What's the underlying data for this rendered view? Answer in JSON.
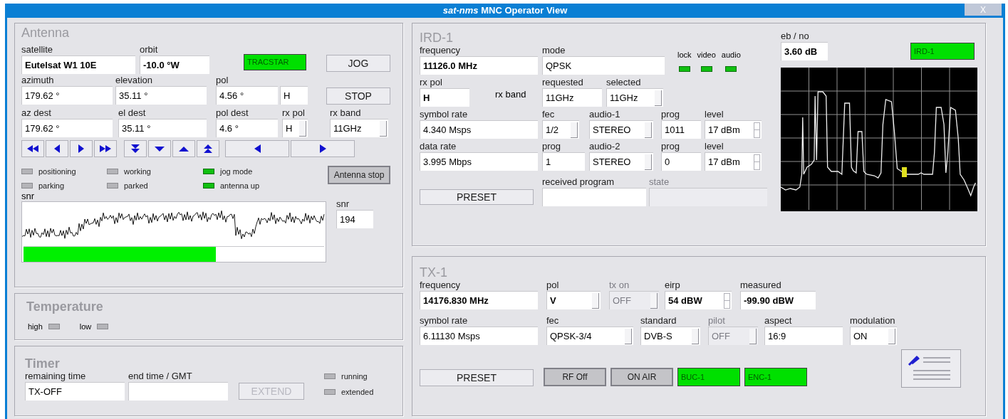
{
  "window": {
    "title": "*sat-nms* MNC Operator View",
    "close": "X"
  },
  "antenna": {
    "title": "Antenna",
    "fields": [
      {
        "label": "satellite",
        "value": "Eutelsat W1 10E",
        "bold": true,
        "kind": "text"
      },
      {
        "label": "orbit",
        "value": "-10.0 °W",
        "bold": true,
        "kind": "text"
      },
      {
        "label": "azimuth",
        "value": "179.62 °",
        "bold": false,
        "kind": "text"
      },
      {
        "label": "elevation",
        "value": "35.11 °",
        "bold": false,
        "kind": "text"
      },
      {
        "label": "pol",
        "value": "4.56 °",
        "bold": false,
        "kind": "text"
      },
      {
        "value": "H",
        "bold": false,
        "kind": "text"
      },
      {
        "label": "az dest",
        "value": "179.62 °",
        "bold": false,
        "kind": "text"
      },
      {
        "label": "el dest",
        "value": "35.11 °",
        "bold": false,
        "kind": "text"
      },
      {
        "label": "pol dest",
        "value": "4.6 °",
        "bold": false,
        "kind": "text"
      },
      {
        "label": "rx pol",
        "value": "H",
        "bold": false,
        "kind": "dropdown"
      },
      {
        "label": "rx band",
        "value": "11GHz",
        "bold": false,
        "kind": "dropdown"
      }
    ],
    "buttons": [
      {
        "label": "TRACSTAR",
        "kind": "green"
      },
      {
        "label": "JOG",
        "kind": "plain"
      },
      {
        "label": "STOP",
        "kind": "plain"
      },
      {
        "label": "Antenna stop",
        "kind": "dark"
      }
    ],
    "indicators": [
      {
        "label": "positioning",
        "on": false
      },
      {
        "label": "parking",
        "on": false
      },
      {
        "label": "working",
        "on": false
      },
      {
        "label": "parked",
        "on": false
      },
      {
        "label": "jog mode",
        "on": true
      },
      {
        "label": "antenna up",
        "on": true
      }
    ],
    "snr": {
      "label": "snr",
      "level": 0.64,
      "value_label": "snr",
      "value": "194",
      "kind": "text"
    }
  },
  "temperature": {
    "title": "Temperature",
    "indicators": [
      {
        "label": "high",
        "on": false
      },
      {
        "label": "low",
        "on": false
      }
    ]
  },
  "timer": {
    "title": "Timer",
    "fields": [
      {
        "label": "remaining time",
        "value": "TX-OFF",
        "bold": false,
        "kind": "text"
      },
      {
        "label": "end time / GMT",
        "kind": "text"
      }
    ],
    "button": {
      "label": "EXTEND",
      "kind": "plain",
      "disabled": true
    },
    "indicators": [
      {
        "label": "running",
        "on": false
      },
      {
        "label": "extended",
        "on": false
      }
    ]
  },
  "ird": {
    "title": "IRD-1",
    "fields": [
      {
        "label": "frequency",
        "value": "11126.0 MHz",
        "bold": true,
        "kind": "text"
      },
      {
        "label": "mode",
        "value": "QPSK",
        "bold": false,
        "kind": "text"
      },
      {
        "label": "rx pol",
        "value": "H",
        "bold": true,
        "kind": "text"
      },
      {
        "label": "requested",
        "value": "11GHz",
        "bold": false,
        "kind": "text"
      },
      {
        "label": "selected",
        "value": "11GHz",
        "bold": false,
        "kind": "dropdown"
      },
      {
        "label": "symbol rate",
        "value": "4.340 Msps",
        "bold": false,
        "kind": "text"
      },
      {
        "label": "fec",
        "value": "1/2",
        "bold": false,
        "kind": "dropdown"
      },
      {
        "label": "audio-1",
        "value": "STEREO",
        "bold": false,
        "kind": "dropdown"
      },
      {
        "label": "prog",
        "value": "1011",
        "bold": false,
        "kind": "text"
      },
      {
        "label": "level",
        "value": "17 dBm",
        "bold": false,
        "kind": "spinner"
      },
      {
        "label": "data rate",
        "value": "3.995 Mbps",
        "bold": false,
        "kind": "text"
      },
      {
        "label": "prog",
        "value": "1",
        "bold": false,
        "kind": "text"
      },
      {
        "label": "audio-2",
        "value": "STEREO",
        "bold": false,
        "kind": "dropdown"
      },
      {
        "label": "prog",
        "value": "0",
        "bold": false,
        "kind": "text"
      },
      {
        "label": "level",
        "value": "17 dBm",
        "bold": false,
        "kind": "spinner"
      },
      {
        "label": "received program",
        "kind": "text"
      },
      {
        "label": "state",
        "kind": "text",
        "disabled": true
      },
      {
        "label": "eb / no",
        "value": "3.60 dB",
        "bold": true,
        "kind": "text"
      }
    ],
    "rx_band_label": "rx band",
    "indicators": [
      {
        "label": "lock",
        "on": true
      },
      {
        "label": "video",
        "on": true
      },
      {
        "label": "audio",
        "on": true
      }
    ],
    "buttons": [
      {
        "label": "PRESET",
        "kind": "plain"
      },
      {
        "label": "IRD-1",
        "kind": "green"
      }
    ]
  },
  "tx": {
    "title": "TX-1",
    "fields": [
      {
        "label": "frequency",
        "value": "14176.830 MHz",
        "bold": true,
        "kind": "text"
      },
      {
        "label": "pol",
        "value": "V",
        "bold": true,
        "kind": "dropdown"
      },
      {
        "label": "tx on",
        "value": "OFF",
        "bold": false,
        "kind": "dropdown",
        "disabled": true
      },
      {
        "label": "eirp",
        "value": "54 dBW",
        "bold": true,
        "kind": "spinner"
      },
      {
        "label": "measured",
        "value": "-99.90 dBW",
        "bold": true,
        "kind": "text"
      },
      {
        "label": "symbol rate",
        "value": "6.11130 Msps",
        "bold": false,
        "kind": "text"
      },
      {
        "label": "fec",
        "value": "QPSK-3/4",
        "bold": false,
        "kind": "dropdown"
      },
      {
        "label": "standard",
        "value": "DVB-S",
        "bold": false,
        "kind": "dropdown"
      },
      {
        "label": "pilot",
        "value": "OFF",
        "bold": false,
        "kind": "dropdown",
        "disabled": true
      },
      {
        "label": "aspect",
        "value": "16:9",
        "bold": false,
        "kind": "text"
      },
      {
        "label": "modulation",
        "value": "ON",
        "bold": false,
        "kind": "dropdown"
      }
    ],
    "buttons": [
      {
        "label": "PRESET",
        "kind": "plain"
      },
      {
        "label": "RF Off",
        "kind": "dark"
      },
      {
        "label": "ON AIR",
        "kind": "dark"
      },
      {
        "label": "BUC-1",
        "kind": "green"
      },
      {
        "label": "ENC-1",
        "kind": "green"
      }
    ]
  }
}
